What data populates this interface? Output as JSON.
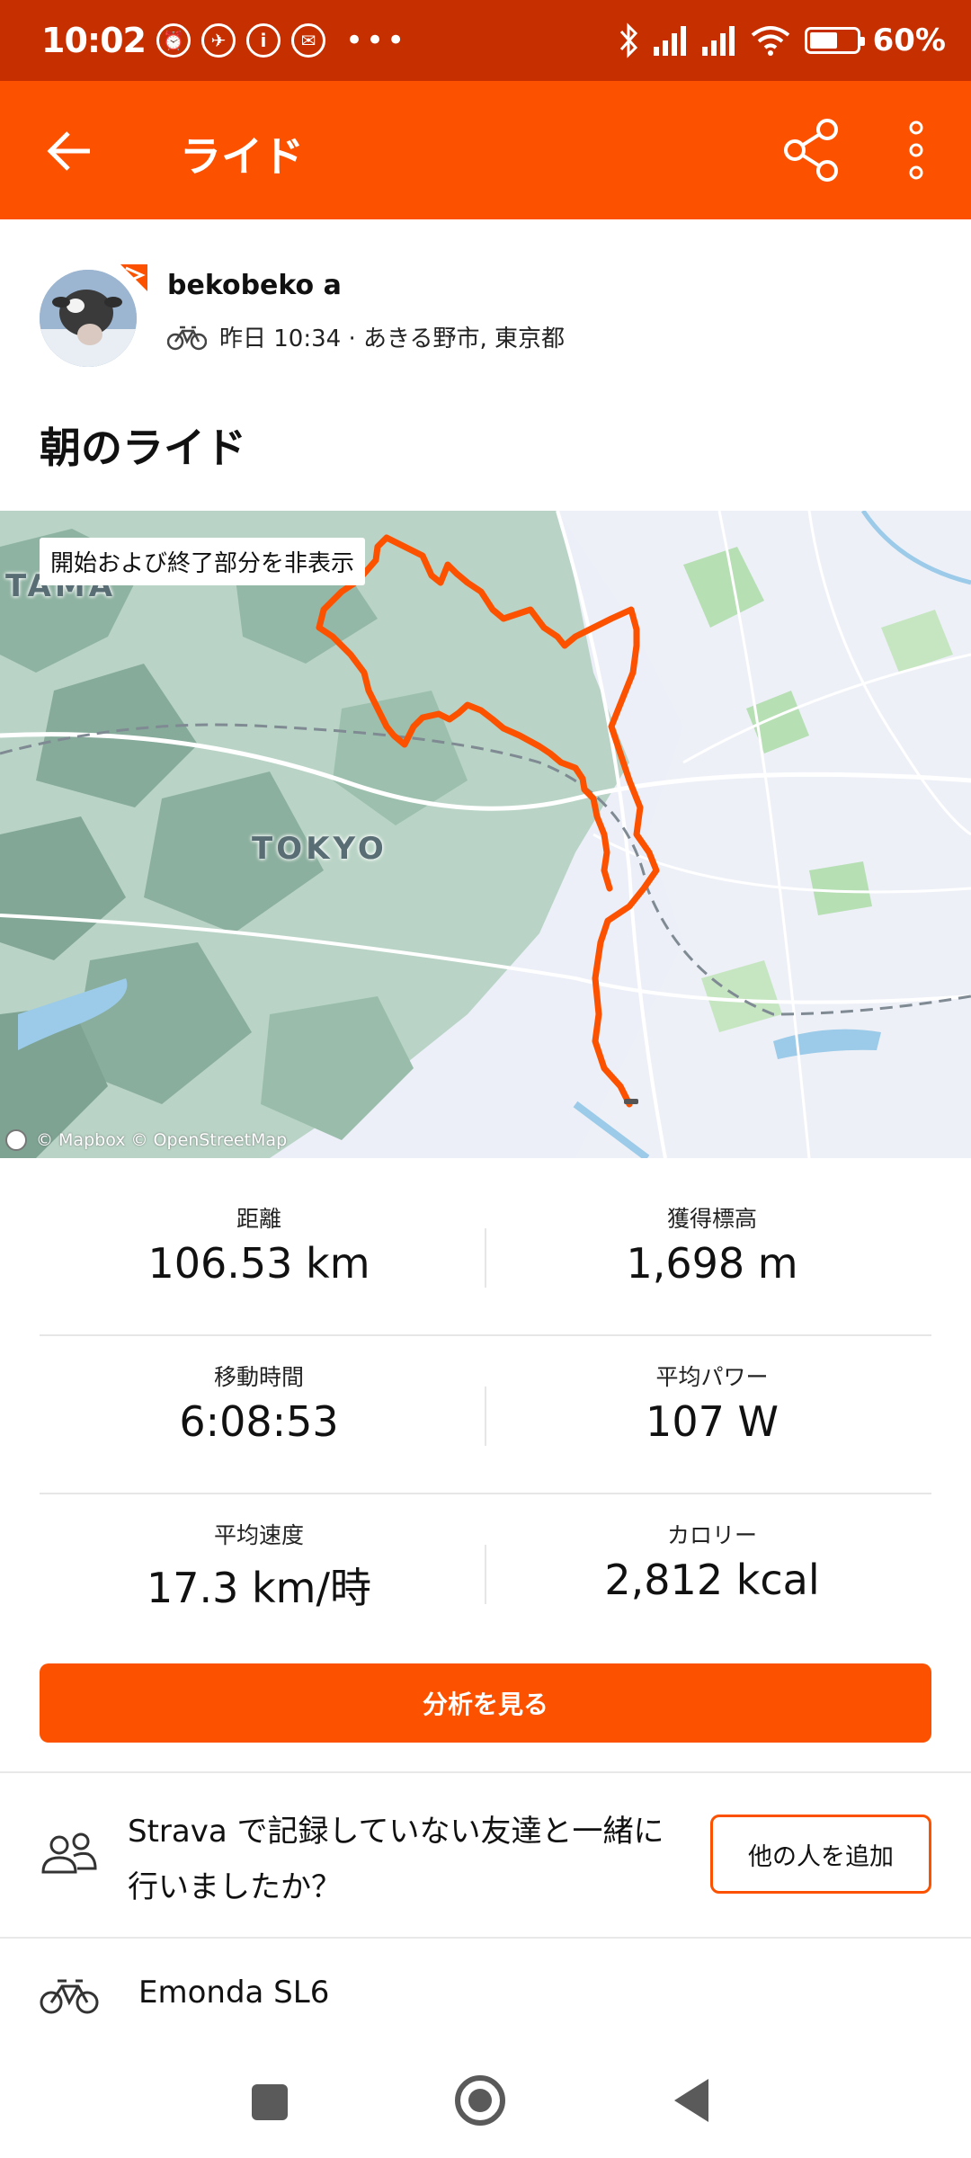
{
  "status_bar": {
    "time": "10:02",
    "battery_percent": "60%",
    "battery_level": 0.6,
    "notification_icons": [
      "alarm-icon",
      "link-icon",
      "info-icon",
      "line-icon"
    ]
  },
  "app_bar": {
    "title": "ライド"
  },
  "athlete": {
    "name": "bekobeko a",
    "activity_meta": "昨日 10:34 · あきる野市, 東京都"
  },
  "activity": {
    "title": "朝のライド"
  },
  "map": {
    "privacy_label": "開始および終了部分を非表示",
    "place_labels": [
      "TAMA",
      "TOKYO"
    ],
    "attribution": "© Mapbox © OpenStreetMap",
    "route_color": "#fc5200"
  },
  "stats": [
    {
      "label": "距離",
      "value": "106.53 km"
    },
    {
      "label": "獲得標高",
      "value": "1,698 m"
    },
    {
      "label": "移動時間",
      "value": "6:08:53"
    },
    {
      "label": "平均パワー",
      "value": "107 W"
    },
    {
      "label": "平均速度",
      "value": "17.3 km/時"
    },
    {
      "label": "カロリー",
      "value": "2,812 kcal"
    }
  ],
  "analyze_button": "分析を見る",
  "friends_prompt": {
    "text": "Strava で記録していない友達と一緒に行いましたか？",
    "button": "他の人を追加"
  },
  "gear": {
    "bike_name": "Emonda SL6"
  },
  "colors": {
    "brand": "#fc5200",
    "status_bar": "#c62f00"
  }
}
